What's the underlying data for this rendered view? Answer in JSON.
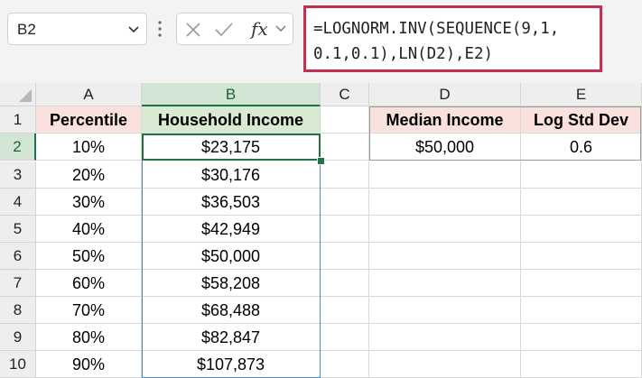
{
  "name_box": {
    "value": "B2"
  },
  "formula_bar": {
    "cancel_icon": "close-icon",
    "enter_icon": "check-icon",
    "fx_label": "fx",
    "formula_line1": "=LOGNORM.INV(SEQUENCE(9,1,",
    "formula_line2": "0.1,0.1),LN(D2),E2)"
  },
  "columns": [
    "A",
    "B",
    "C",
    "D",
    "E"
  ],
  "rows": [
    "1",
    "2",
    "3",
    "4",
    "5",
    "6",
    "7",
    "8",
    "9",
    "10"
  ],
  "headers": {
    "a1": "Percentile",
    "b1": "Household Income",
    "d1": "Median Income",
    "e1": "Log Std Dev"
  },
  "percentiles": [
    "10%",
    "20%",
    "30%",
    "40%",
    "50%",
    "60%",
    "70%",
    "80%",
    "90%"
  ],
  "incomes": [
    "$23,175",
    "$30,176",
    "$36,503",
    "$42,949",
    "$50,000",
    "$58,208",
    "$68,488",
    "$82,847",
    "$107,873"
  ],
  "inputs": {
    "d2": "$50,000",
    "e2": "0.6"
  },
  "colors": {
    "highlight_border": "#c0304f",
    "selection": "#217346",
    "spill_border": "#4f86c6",
    "header_pink": "#fbe1de",
    "header_green": "#d9ead3"
  }
}
